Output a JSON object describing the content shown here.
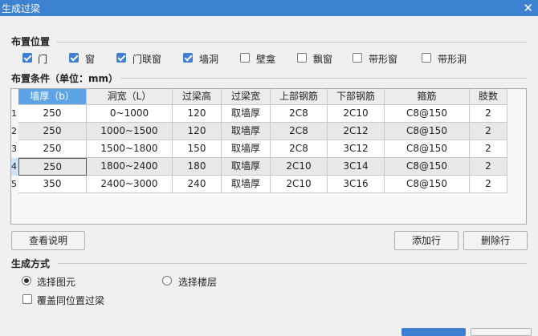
{
  "window": {
    "title": "生成过梁",
    "close_glyph": "✕"
  },
  "placement": {
    "label": "布置位置",
    "options": [
      {
        "label": "门",
        "checked": true
      },
      {
        "label": "窗",
        "checked": true
      },
      {
        "label": "门联窗",
        "checked": true
      },
      {
        "label": "墙洞",
        "checked": true
      },
      {
        "label": "壁龛",
        "checked": false
      },
      {
        "label": "飘窗",
        "checked": false
      },
      {
        "label": "带形窗",
        "checked": false
      },
      {
        "label": "带形洞",
        "checked": false
      }
    ]
  },
  "conditions": {
    "label": "布置条件（单位：mm）",
    "columns": [
      "墙厚（b）",
      "洞宽（L）",
      "过梁高",
      "过梁宽",
      "上部钢筋",
      "下部钢筋",
      "箍筋",
      "肢数"
    ],
    "rows": [
      {
        "num": "1",
        "cells": [
          "250",
          "0~1000",
          "120",
          "取墙厚",
          "2C8",
          "2C10",
          "C8@150",
          "2"
        ]
      },
      {
        "num": "2",
        "cells": [
          "250",
          "1000~1500",
          "120",
          "取墙厚",
          "2C8",
          "2C12",
          "C8@150",
          "2"
        ]
      },
      {
        "num": "3",
        "cells": [
          "250",
          "1500~1800",
          "150",
          "取墙厚",
          "2C8",
          "3C12",
          "C8@150",
          "2"
        ]
      },
      {
        "num": "4",
        "cells": [
          "250",
          "1800~2400",
          "180",
          "取墙厚",
          "2C10",
          "3C14",
          "C8@150",
          "2"
        ]
      },
      {
        "num": "5",
        "cells": [
          "350",
          "2400~3000",
          "240",
          "取墙厚",
          "2C10",
          "3C16",
          "C8@150",
          "2"
        ]
      }
    ]
  },
  "buttons": {
    "view_help": "查看说明",
    "add_row": "添加行",
    "delete_row": "删除行"
  },
  "generate": {
    "label": "生成方式",
    "options": [
      {
        "label": "选择图元",
        "checked": true
      },
      {
        "label": "选择楼层",
        "checked": false
      }
    ],
    "overwrite": {
      "label": "覆盖同位置过梁",
      "checked": false
    }
  }
}
